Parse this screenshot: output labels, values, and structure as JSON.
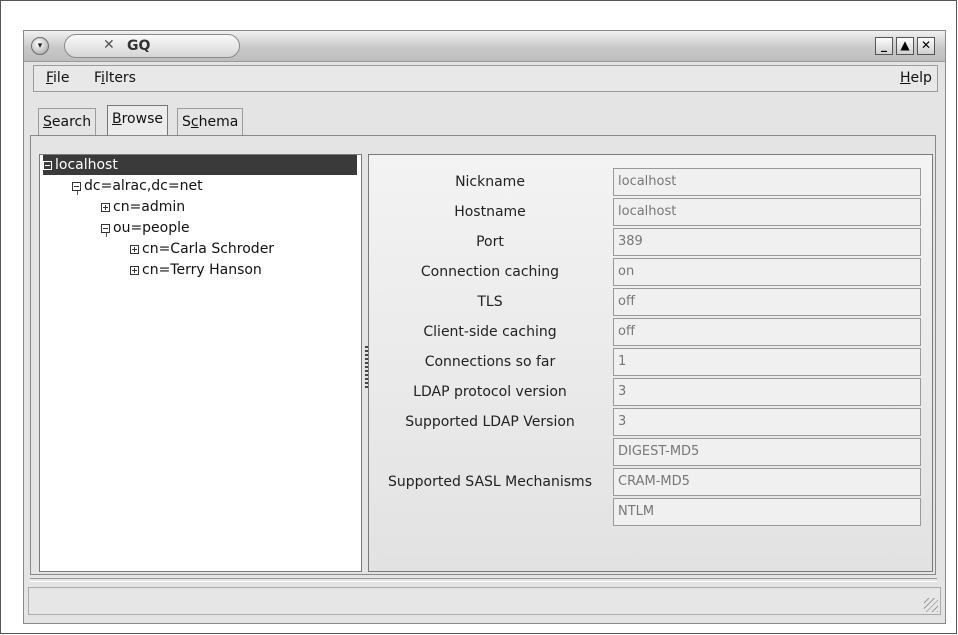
{
  "window": {
    "title": "GQ",
    "controls": {
      "minimize": "_",
      "maximize": "▲",
      "close": "✕"
    }
  },
  "menubar": {
    "file": {
      "label": "File",
      "accel": "F",
      "rest": "ile"
    },
    "filters": {
      "label": "Filters",
      "pre": "F",
      "accel": "i",
      "rest": "lters"
    },
    "help": {
      "label": "Help",
      "accel": "H",
      "rest": "elp"
    }
  },
  "tabs": [
    {
      "label": "Search",
      "accel": "S",
      "rest": "earch",
      "active": false
    },
    {
      "label": "Browse",
      "accel": "B",
      "rest": "rowse",
      "active": true
    },
    {
      "label": "Schema",
      "pre": "S",
      "accel": "c",
      "rest": "hema",
      "active": false
    }
  ],
  "tree": [
    {
      "label": "localhost",
      "expanded": true,
      "selected": true,
      "depth": 0
    },
    {
      "label": "dc=alrac,dc=net",
      "expanded": true,
      "selected": false,
      "depth": 1
    },
    {
      "label": "cn=admin",
      "expanded": false,
      "selected": false,
      "depth": 2
    },
    {
      "label": "ou=people",
      "expanded": true,
      "selected": false,
      "depth": 2
    },
    {
      "label": "cn=Carla Schroder",
      "expanded": false,
      "selected": false,
      "depth": 3
    },
    {
      "label": "cn=Terry Hanson",
      "expanded": false,
      "selected": false,
      "depth": 3
    }
  ],
  "properties": [
    {
      "label": "Nickname",
      "value": "localhost"
    },
    {
      "label": "Hostname",
      "value": "localhost"
    },
    {
      "label": "Port",
      "value": "389"
    },
    {
      "label": "Connection caching",
      "value": "on"
    },
    {
      "label": "TLS",
      "value": "off"
    },
    {
      "label": "Client-side caching",
      "value": "off"
    },
    {
      "label": "Connections so far",
      "value": "1"
    },
    {
      "label": "LDAP protocol version",
      "value": "3"
    },
    {
      "label": "Supported LDAP Version",
      "value": "3"
    }
  ],
  "sasl": {
    "label": "Supported SASL Mechanisms",
    "values": [
      "DIGEST-MD5",
      "CRAM-MD5",
      "NTLM"
    ]
  },
  "statusbar": {
    "text": ""
  }
}
